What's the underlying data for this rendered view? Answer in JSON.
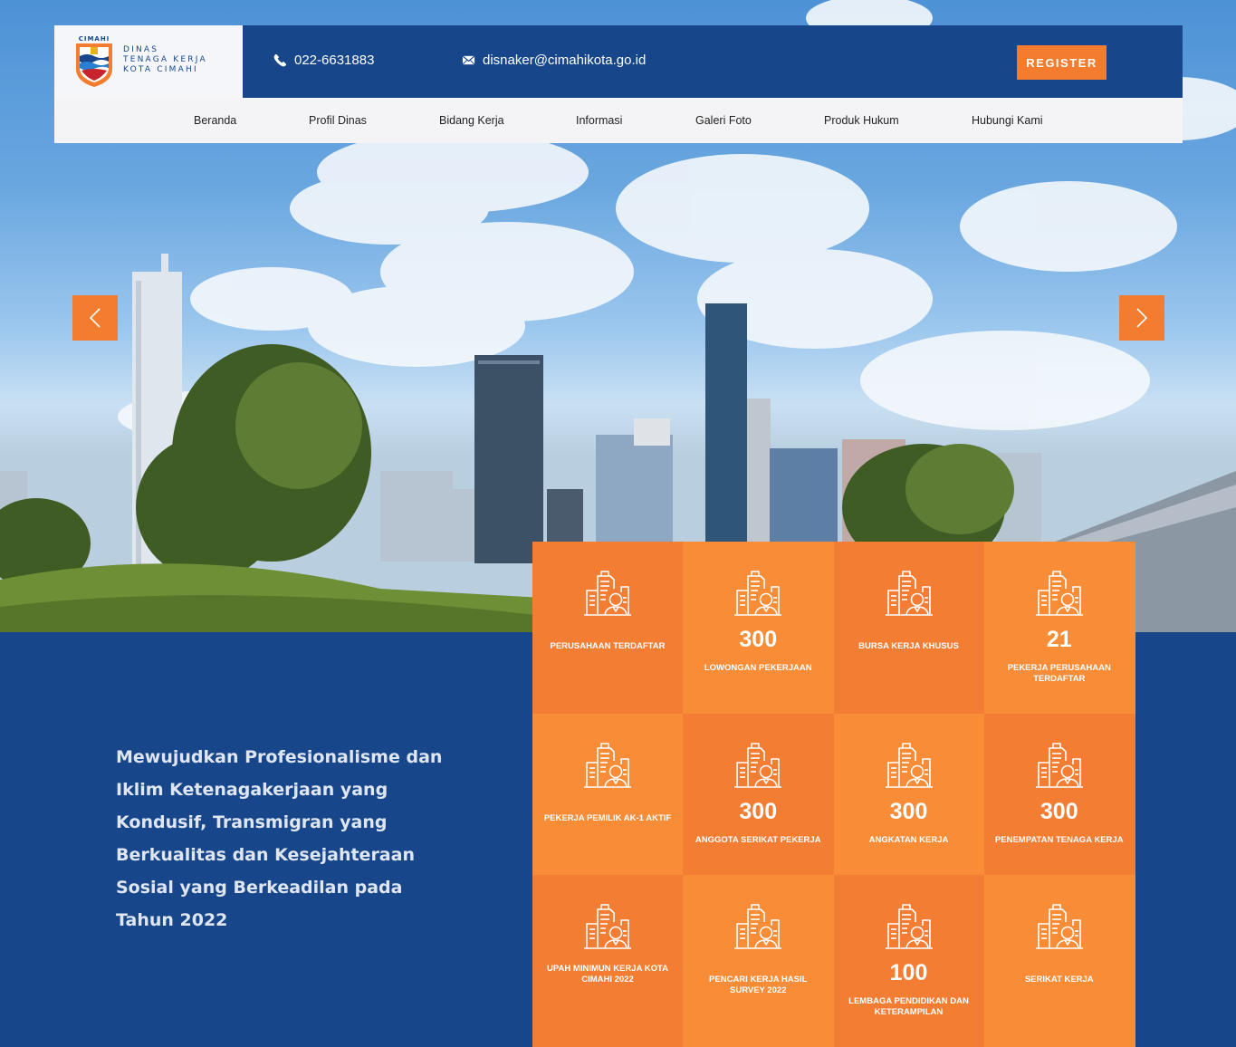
{
  "header": {
    "logo_top_text": "CIMAHI",
    "logo_lines": [
      "DINAS",
      "TENAGA KERJA",
      "KOTA CIMAHI"
    ],
    "phone": "022-6631883",
    "email": "disnaker@cimahikota.go.id",
    "register_label": "REGISTER"
  },
  "nav": {
    "items": [
      {
        "label": "Beranda"
      },
      {
        "label": "Profil Dinas"
      },
      {
        "label": "Bidang Kerja"
      },
      {
        "label": "Informasi"
      },
      {
        "label": "Galeri Foto"
      },
      {
        "label": "Produk Hukum"
      },
      {
        "label": "Hubungi Kami"
      }
    ]
  },
  "slider": {
    "prev_icon": "chevron-left-icon",
    "next_icon": "chevron-right-icon"
  },
  "vision": {
    "text": "Mewujudkan Profesionalisme dan Iklim Ketenagakerjaan yang Kondusif, Transmigran yang Berkualitas dan Kesejahteraan Sosial yang Berkeadilan pada Tahun 2022"
  },
  "stats": {
    "icon": "office-building-person-icon",
    "colors": {
      "dark": "#f47d34",
      "light": "#f98c36"
    },
    "items": [
      {
        "value": "",
        "label": "PERUSAHAAN TERDAFTAR"
      },
      {
        "value": "300",
        "label": "LOWONGAN PEKERJAAN"
      },
      {
        "value": "",
        "label": "BURSA KERJA KHUSUS"
      },
      {
        "value": "21",
        "label": "PEKERJA PERUSAHAAN TERDAFTAR"
      },
      {
        "value": "",
        "label": "PEKERJA PEMILIK AK-1 AKTIF"
      },
      {
        "value": "300",
        "label": "ANGGOTA SERIKAT PEKERJA"
      },
      {
        "value": "300",
        "label": "ANGKATAN KERJA"
      },
      {
        "value": "300",
        "label": "PENEMPATAN TENAGA KERJA"
      },
      {
        "value": "",
        "label": "UPAH MINIMUN KERJA KOTA CIMAHI 2022"
      },
      {
        "value": "",
        "label": "PENCARI KERJA HASIL SURVEY 2022"
      },
      {
        "value": "100",
        "label": "LEMBAGA PENDIDIKAN DAN KETERAMPILAN"
      },
      {
        "value": "",
        "label": "SERIKAT KERJA"
      }
    ]
  }
}
